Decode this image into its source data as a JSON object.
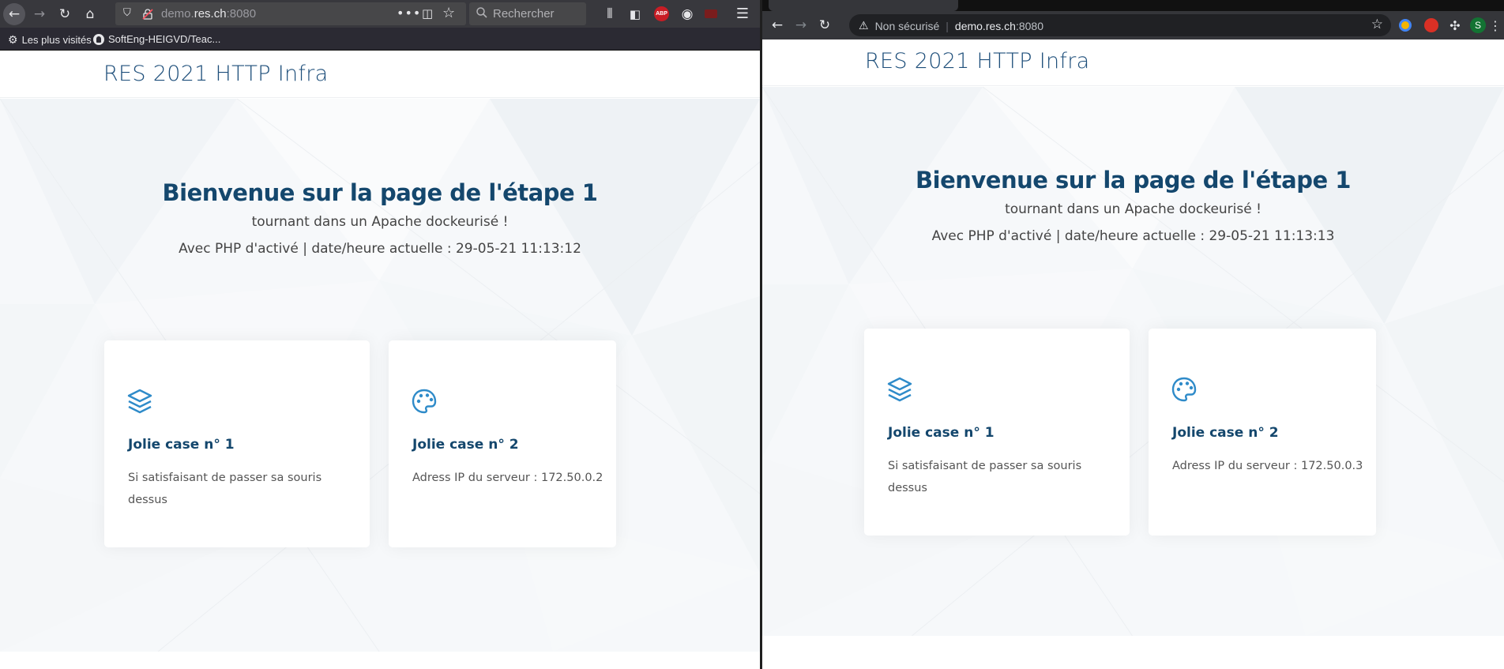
{
  "firefox": {
    "url_prefix": "demo.",
    "url_domain": "res.ch",
    "url_port": ":8080",
    "search_placeholder": "Rechercher",
    "bookmarks": [
      {
        "label": "Les plus visités"
      },
      {
        "label": "SoftEng-HEIGVD/Teac..."
      }
    ],
    "abp_badge": "ABP"
  },
  "chrome": {
    "security_label": "Non sécurisé",
    "url_domain": "demo.res.ch",
    "url_port": ":8080",
    "profile_initial": "S"
  },
  "left_page": {
    "site_title": "RES 2021 HTTP Infra",
    "hero_title": "Bienvenue sur la page de l'étape 1",
    "hero_subtitle": "tournant dans un Apache dockeurisé !",
    "hero_status": "Avec PHP d'activé | date/heure actuelle : 29-05-21 11:13:12",
    "cards": [
      {
        "icon": "layers-icon",
        "title": "Jolie case n° 1",
        "text": "Si satisfaisant de passer sa souris dessus"
      },
      {
        "icon": "palette-icon",
        "title": "Jolie case n° 2",
        "text": "Adress IP du serveur : 172.50.0.2"
      }
    ]
  },
  "right_page": {
    "site_title": "RES 2021 HTTP Infra",
    "hero_title": "Bienvenue sur la page de l'étape 1",
    "hero_subtitle": "tournant dans un Apache dockeurisé !",
    "hero_status": "Avec PHP d'activé | date/heure actuelle : 29-05-21 11:13:13",
    "cards": [
      {
        "icon": "layers-icon",
        "title": "Jolie case n° 1",
        "text": "Si satisfaisant de passer sa souris dessus"
      },
      {
        "icon": "palette-icon",
        "title": "Jolie case n° 2",
        "text": "Adress IP du serveur : 172.50.0.3"
      }
    ]
  },
  "colors": {
    "accent": "#2f8bc9",
    "title": "#14476d"
  }
}
